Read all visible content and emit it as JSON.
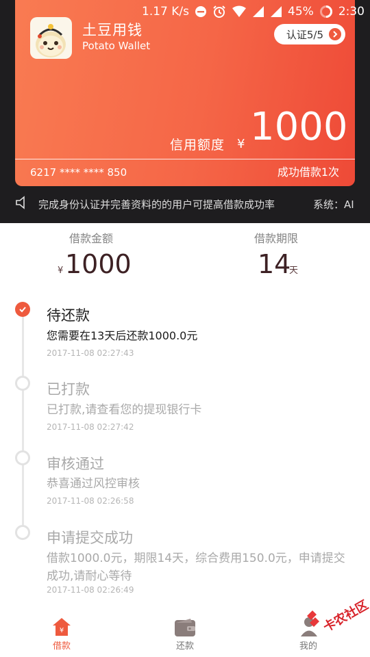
{
  "status_bar": {
    "speed": "1.17 K/s",
    "battery": "45%",
    "time": "2:30"
  },
  "card": {
    "brand_cn": "土豆用钱",
    "brand_en": "Potato Wallet",
    "verify_label": "认证5/5",
    "credit_label": "信用额度",
    "currency": "¥",
    "credit_amount": "1000",
    "card_number": "6217 **** ****  850",
    "loan_count": "成功借款1次"
  },
  "notice": {
    "message": "完成身份认证并完善资料的的用户可提高借款成功率",
    "system": "系统：AI"
  },
  "loan_info": {
    "amount_label": "借款金额",
    "currency": "¥",
    "amount": "1000",
    "period_label": "借款期限",
    "period": "14",
    "period_unit": "天"
  },
  "timeline": [
    {
      "title": "待还款",
      "desc": "您需要在13天后还款1000.0元",
      "time": "2017-11-08 02:27:43"
    },
    {
      "title": "已打款",
      "desc": "已打款,请查看您的提现银行卡",
      "time": "2017-11-08 02:27:42"
    },
    {
      "title": "审核通过",
      "desc": "恭喜通过风控审核",
      "time": "2017-11-08 02:26:58"
    },
    {
      "title": "申请提交成功",
      "desc": "借款1000.0元，期限14天，综合费用150.0元，申请提交成功,请耐心等待",
      "time": "2017-11-08 02:26:49"
    }
  ],
  "nav": {
    "loan": "借款",
    "repay": "还款",
    "mine": "我的"
  },
  "watermark": "卡农社区",
  "colors": {
    "accent": "#ee5a3e",
    "dark_text": "#3d2124",
    "muted": "#9e9e9e"
  }
}
